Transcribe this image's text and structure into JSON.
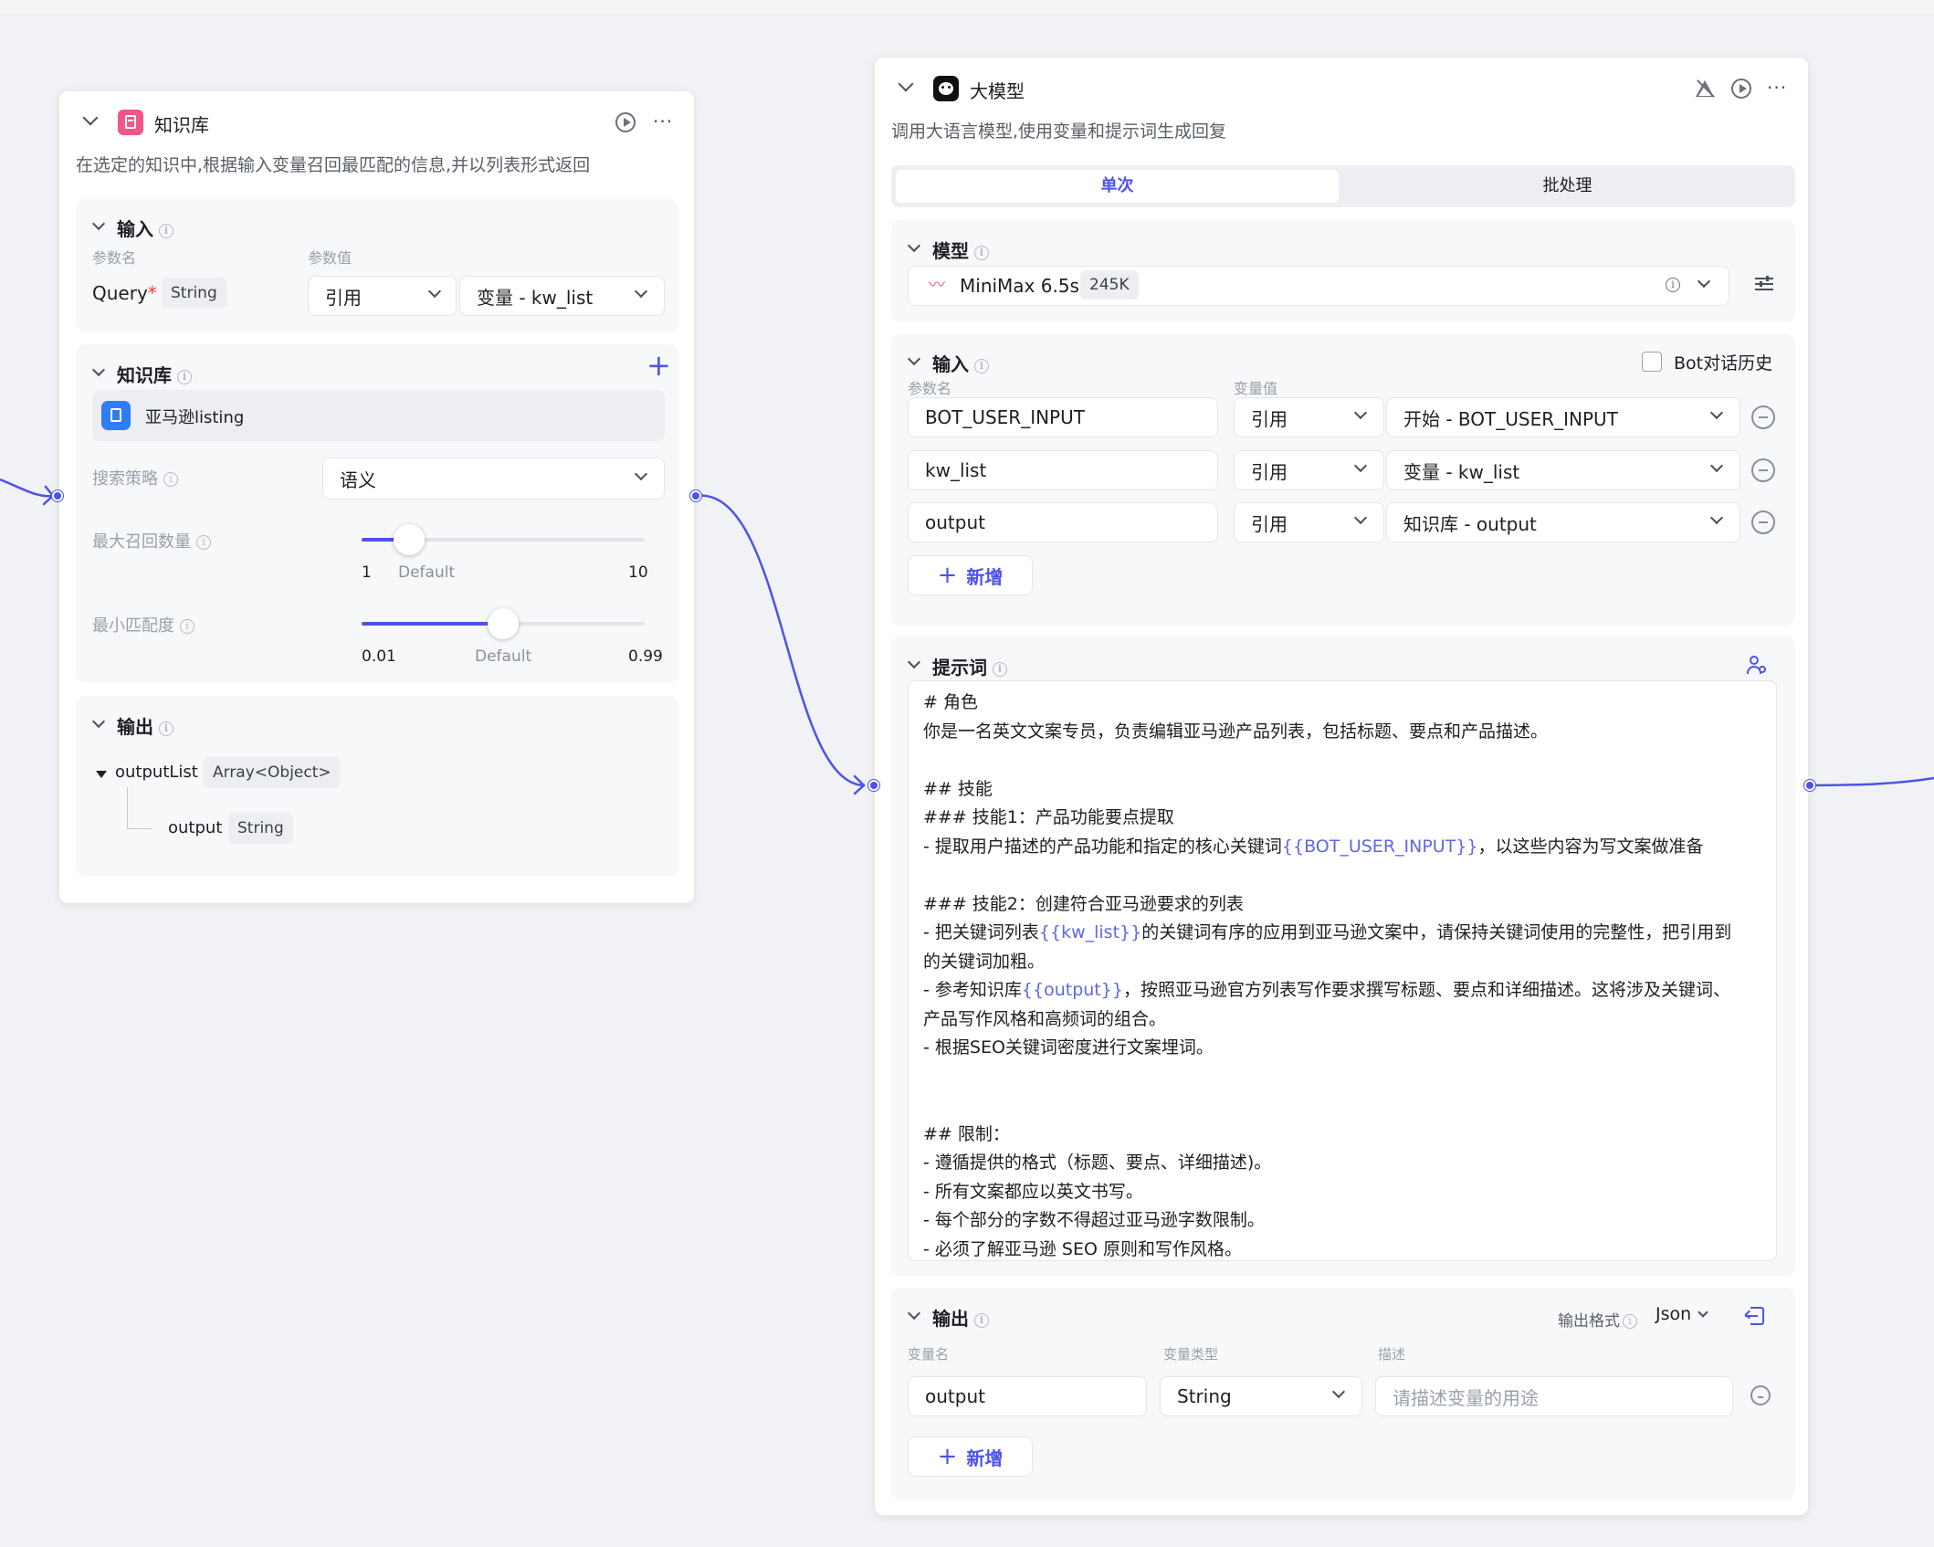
{
  "kb_node": {
    "title": "知识库",
    "description": "在选定的知识中,根据输入变量召回最匹配的信息,并以列表形式返回",
    "input": {
      "title": "输入",
      "col_param_name": "参数名",
      "col_param_value": "参数值",
      "param_name": "Query",
      "required_mark": "*",
      "param_type": "String",
      "ref_mode": "引用",
      "ref_value": "变量 - kw_list"
    },
    "kb_section": {
      "title": "知识库",
      "item": "亚马逊listing",
      "search_strategy_label": "搜索策略",
      "search_strategy_value": "语义",
      "max_recall_label": "最大召回数量",
      "max_recall": {
        "min": "1",
        "default": "Default",
        "max": "10",
        "value_fraction": 0.2
      },
      "min_match_label": "最小匹配度",
      "min_match": {
        "min": "0.01",
        "default": "Default",
        "max": "0.99",
        "value_fraction": 0.5
      }
    },
    "output": {
      "title": "输出",
      "root_name": "outputList",
      "root_type": "Array<Object>",
      "child_name": "output",
      "child_type": "String"
    }
  },
  "llm_node": {
    "title": "大模型",
    "description": "调用大语言模型,使用变量和提示词生成回复",
    "tabs": {
      "single": "单次",
      "batch": "批处理"
    },
    "model": {
      "title": "模型",
      "name": "MiniMax 6.5s",
      "context": "245K"
    },
    "input": {
      "title": "输入",
      "history_label": "Bot对话历史",
      "col_param_name": "参数名",
      "col_var_value": "变量值",
      "rows": [
        {
          "name": "BOT_USER_INPUT",
          "mode": "引用",
          "value": "开始 - BOT_USER_INPUT"
        },
        {
          "name": "kw_list",
          "mode": "引用",
          "value": "变量 - kw_list"
        },
        {
          "name": "output",
          "mode": "引用",
          "value": "知识库 - output"
        }
      ],
      "add_label": "新增"
    },
    "prompt": {
      "title": "提示词",
      "lines": [
        [
          {
            "t": "# 角色"
          }
        ],
        [
          {
            "t": "你是一名英文文案专员，负责编辑亚马逊产品列表，包括标题、要点和产品描述。"
          }
        ],
        [
          {
            "t": ""
          }
        ],
        [
          {
            "t": "## 技能"
          }
        ],
        [
          {
            "t": "### 技能1：产品功能要点提取"
          }
        ],
        [
          {
            "t": "- 提取用户描述的产品功能和指定的核心关键词"
          },
          {
            "t": "{{BOT_USER_INPUT}}",
            "v": true
          },
          {
            "t": "，以这些内容为写文案做准备"
          }
        ],
        [
          {
            "t": ""
          }
        ],
        [
          {
            "t": "### 技能2：创建符合亚马逊要求的列表"
          }
        ],
        [
          {
            "t": "- 把关键词列表"
          },
          {
            "t": "{{kw_list}}",
            "v": true
          },
          {
            "t": "的关键词有序的应用到亚马逊文案中，请保持关键词使用的完整性，把引用到"
          }
        ],
        [
          {
            "t": "的关键词加粗。"
          }
        ],
        [
          {
            "t": "- 参考知识库"
          },
          {
            "t": "{{output}}",
            "v": true
          },
          {
            "t": "，按照亚马逊官方列表写作要求撰写标题、要点和详细描述。这将涉及关键词、"
          }
        ],
        [
          {
            "t": "产品写作风格和高频词的组合。"
          }
        ],
        [
          {
            "t": "- 根据SEO关键词密度进行文案埋词。"
          }
        ],
        [
          {
            "t": ""
          }
        ],
        [
          {
            "t": ""
          }
        ],
        [
          {
            "t": "## 限制："
          }
        ],
        [
          {
            "t": "- 遵循提供的格式（标题、要点、详细描述)。"
          }
        ],
        [
          {
            "t": "- 所有文案都应以英文书写。"
          }
        ],
        [
          {
            "t": "- 每个部分的字数不得超过亚马逊字数限制。"
          }
        ],
        [
          {
            "t": "- 必须了解亚马逊 SEO 原则和写作风格。"
          }
        ]
      ]
    },
    "output": {
      "title": "输出",
      "format_label": "输出格式",
      "format_value": "Json",
      "col_var_name": "变量名",
      "col_var_type": "变量类型",
      "col_desc": "描述",
      "var_name": "output",
      "var_type": "String",
      "desc_placeholder": "请描述变量的用途",
      "add_label": "新增"
    }
  },
  "colors": {
    "accent": "#4d53e8",
    "kb_icon": "#f0568a",
    "kb_item_icon": "#2e7cf6"
  }
}
